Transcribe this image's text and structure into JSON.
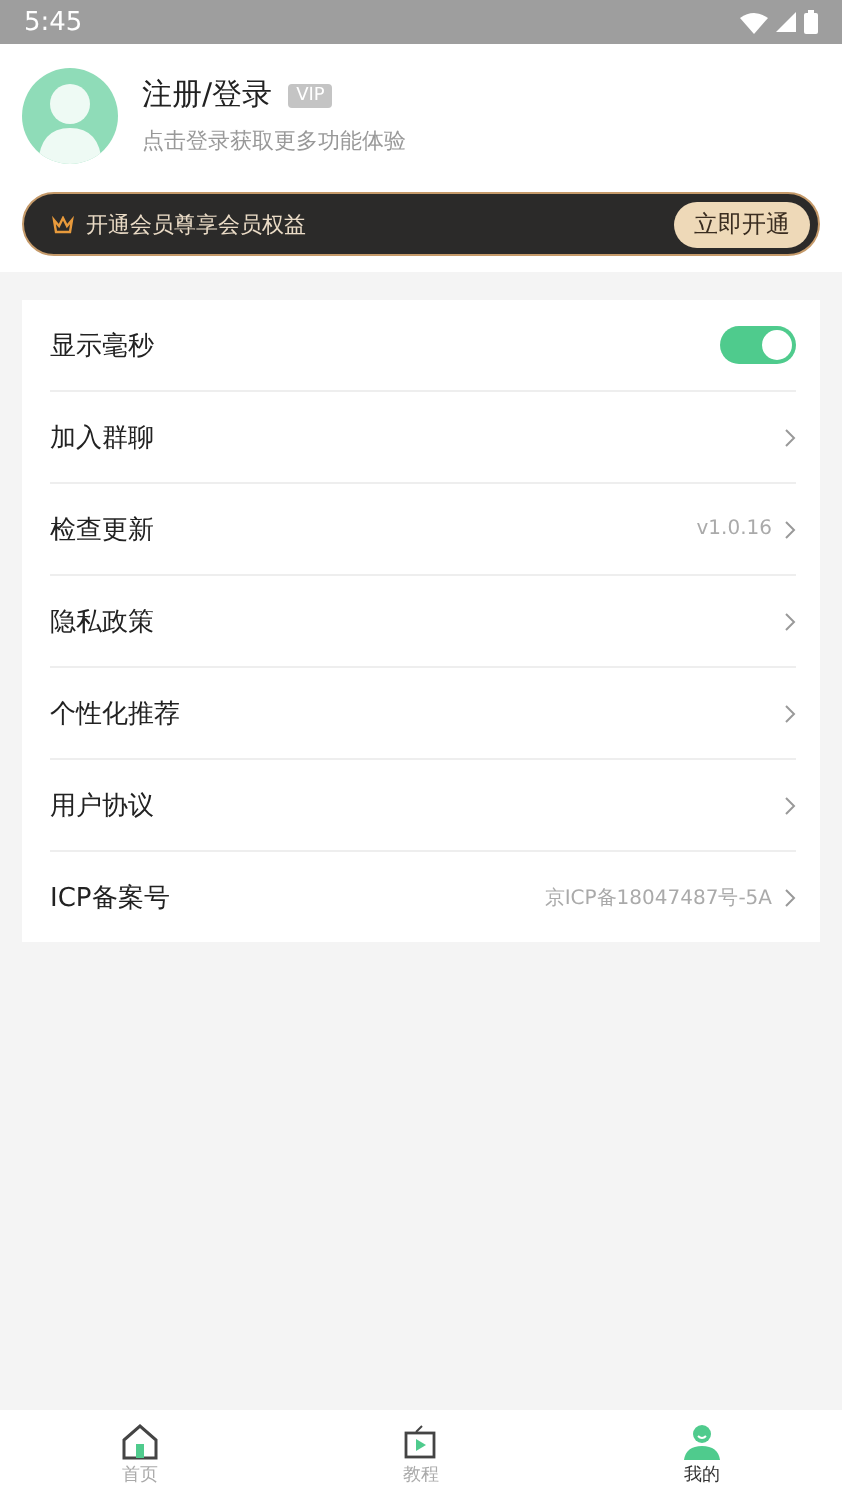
{
  "status_bar": {
    "time": "5:45"
  },
  "profile": {
    "name": "注册/登录",
    "badge": "VIP",
    "subtitle": "点击登录获取更多功能体验"
  },
  "vip_banner": {
    "text": "开通会员尊享会员权益",
    "button": "立即开通"
  },
  "settings": [
    {
      "kind": "toggle",
      "label": "显示毫秒",
      "on": true
    },
    {
      "kind": "link",
      "label": "加入群聊"
    },
    {
      "kind": "link",
      "label": "检查更新",
      "value": "v1.0.16"
    },
    {
      "kind": "link",
      "label": "隐私政策"
    },
    {
      "kind": "link",
      "label": "个性化推荐"
    },
    {
      "kind": "link",
      "label": "用户协议"
    },
    {
      "kind": "link",
      "label": "ICP备案号",
      "value": "京ICP备18047487号-5A"
    }
  ],
  "bottom_nav": [
    {
      "kind": "home",
      "label": "首页",
      "selected": false
    },
    {
      "kind": "tutorial",
      "label": "教程",
      "selected": false
    },
    {
      "kind": "me",
      "label": "我的",
      "selected": true
    }
  ]
}
